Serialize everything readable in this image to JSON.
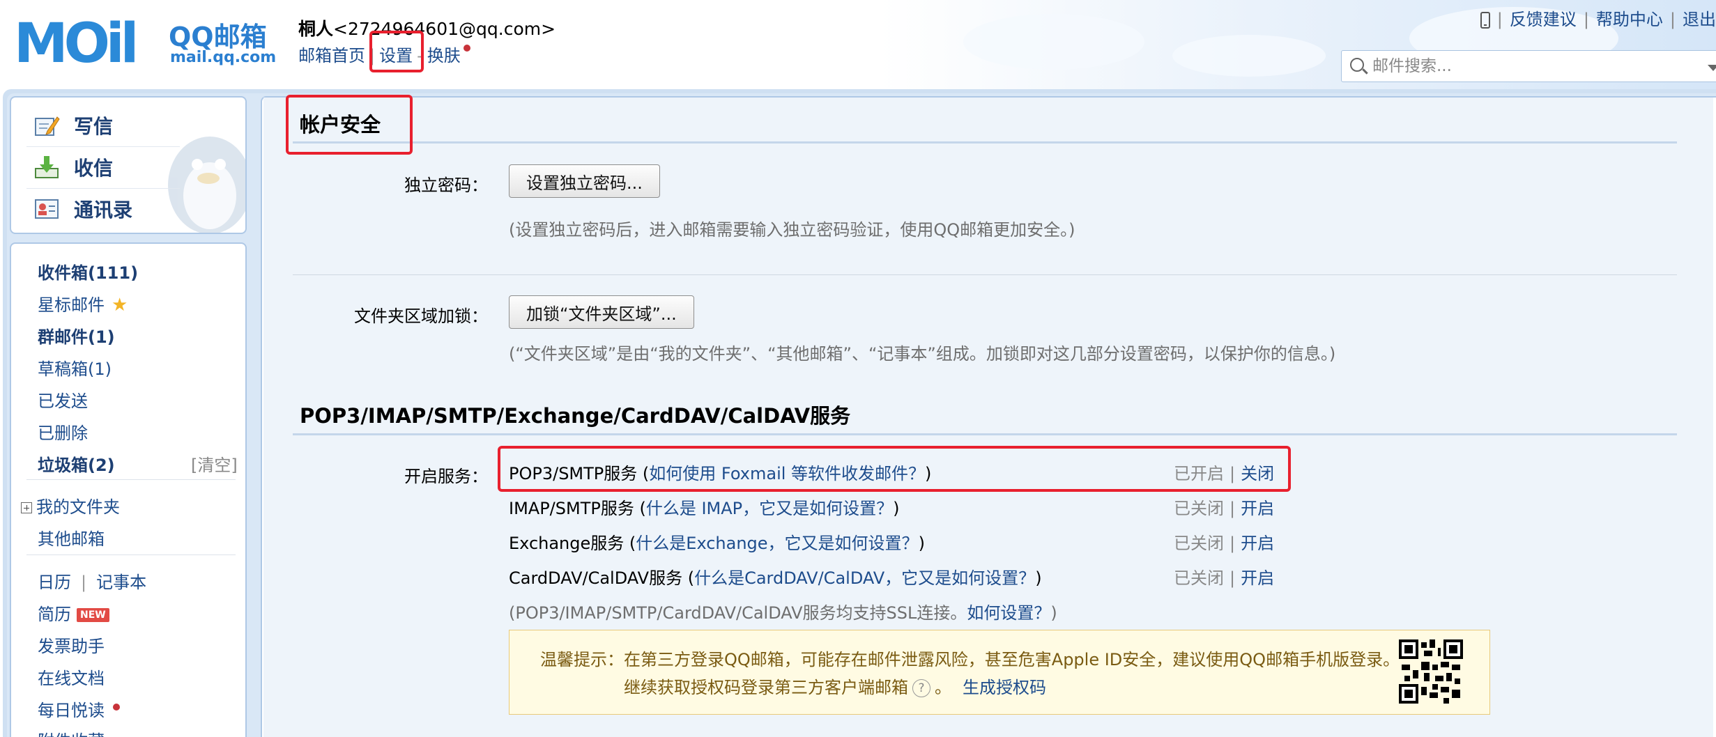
{
  "header": {
    "logo_text": "MOil",
    "logo_brand": "QQ邮箱",
    "logo_domain": "mail.qq.com",
    "user_name": "桐人",
    "user_email": "<2724964601@qq.com>",
    "nav": {
      "home": "邮箱首页",
      "settings": "设置",
      "skin": "换肤"
    },
    "top_right": {
      "feedback": "反馈建议",
      "help": "帮助中心",
      "logout": "退出"
    },
    "search_placeholder": "邮件搜索..."
  },
  "sidebar": {
    "compose": {
      "write": "写信",
      "receive": "收信",
      "contacts": "通讯录"
    },
    "items": {
      "inbox": "收件箱(111)",
      "starred": "星标邮件",
      "group": "群邮件(1)",
      "drafts": "草稿箱(1)",
      "sent": "已发送",
      "deleted": "已删除",
      "spam": "垃圾箱(2)",
      "spam_clear": "[清空]",
      "my_folders": "我的文件夹",
      "other_mail": "其他邮箱",
      "calendar": "日历",
      "notes": "记事本",
      "resume": "简历",
      "resume_badge": "NEW",
      "invoice": "发票助手",
      "docs": "在线文档",
      "daily": "每日悦读",
      "attachments": "附件收藏"
    }
  },
  "main": {
    "account_security": "帐户安全",
    "independent_pwd": {
      "label": "独立密码：",
      "button": "设置独立密码...",
      "hint": "(设置独立密码后，进入邮箱需要输入独立密码验证，使用QQ邮箱更加安全。)"
    },
    "folder_lock": {
      "label": "文件夹区域加锁：",
      "button": "加锁“文件夹区域”...",
      "hint": "(“文件夹区域”是由“我的文件夹”、“其他邮箱”、“记事本”组成。加锁即对这几部分设置密码，以保护你的信息。)"
    },
    "services_title": "POP3/IMAP/SMTP/Exchange/CardDAV/CalDAV服务",
    "enable_label": "开启服务：",
    "services": [
      {
        "name": "POP3/SMTP服务",
        "link": "如何使用 Foxmail 等软件收发邮件？",
        "status": "已开启",
        "toggle": "关闭"
      },
      {
        "name": "IMAP/SMTP服务",
        "link": "什么是 IMAP，它又是如何设置？",
        "status": "已关闭",
        "toggle": "开启"
      },
      {
        "name": "Exchange服务",
        "link": "什么是Exchange，它又是如何设置？",
        "status": "已关闭",
        "toggle": "开启"
      },
      {
        "name": "CardDAV/CalDAV服务",
        "link": "什么是CardDAV/CalDAV，它又是如何设置？",
        "status": "已关闭",
        "toggle": "开启"
      }
    ],
    "ssl_note": "(POP3/IMAP/SMTP/CardDAV/CalDAV服务均支持SSL连接。",
    "ssl_link": "如何设置？",
    "tip": {
      "prefix": "温馨提示：",
      "line1": "在第三方登录QQ邮箱，可能存在邮件泄露风险，甚至危害Apple ID安全，建议使用QQ邮箱手机版登录。",
      "line2": "继续获取授权码登录第三方客户端邮箱",
      "line2_end": "。",
      "generate": "生成授权码"
    }
  },
  "colors": {
    "link": "#1d4c8c",
    "annotation": "#e8202e",
    "accent": "#2b8ad8",
    "tip_bg": "#fffbe3"
  }
}
